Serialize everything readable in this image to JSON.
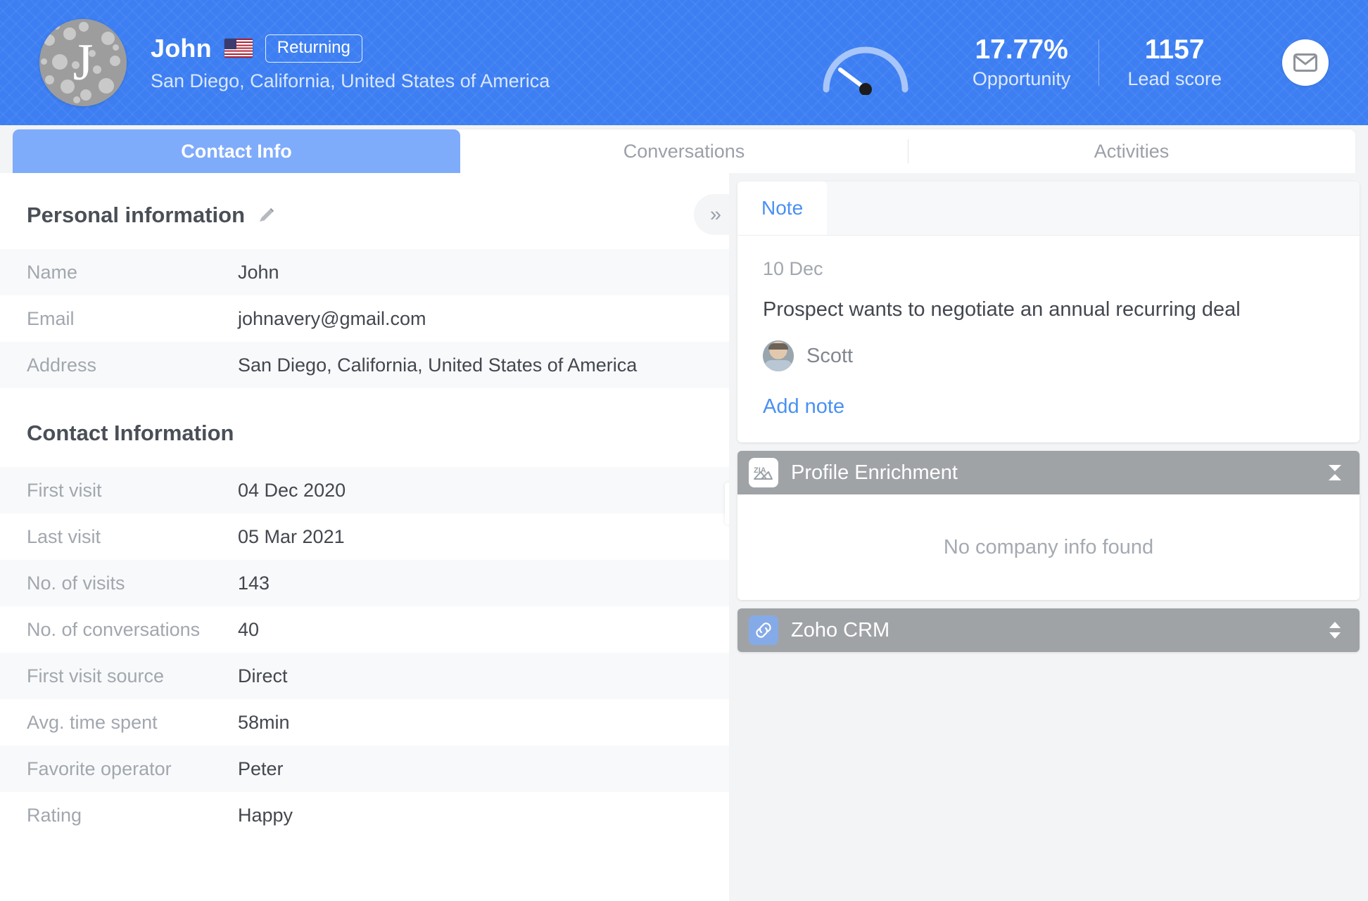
{
  "header": {
    "avatar_letter": "J",
    "name": "John",
    "country_flag": "us-flag-icon",
    "badge": "Returning",
    "location": "San Diego, California, United States of America",
    "gauge_icon": "gauge-icon",
    "opportunity_value": "17.77%",
    "opportunity_label": "Opportunity",
    "lead_score_value": "1157",
    "lead_score_label": "Lead score",
    "mail_icon": "mail-icon",
    "accent_color": "#3d7ff2"
  },
  "tabs": [
    {
      "label": "Contact Info",
      "active": true
    },
    {
      "label": "Conversations",
      "active": false
    },
    {
      "label": "Activities",
      "active": false
    }
  ],
  "personal": {
    "title": "Personal information",
    "edit_icon": "pencil-icon",
    "rows": [
      {
        "label": "Name",
        "value": "John"
      },
      {
        "label": "Email",
        "value": "johnavery@gmail.com"
      },
      {
        "label": "Address",
        "value": "San Diego, California, United States of America"
      }
    ]
  },
  "contact": {
    "title": "Contact Information",
    "rows": [
      {
        "label": "First visit",
        "value": "04 Dec 2020"
      },
      {
        "label": "Last visit",
        "value": "05 Mar 2021"
      },
      {
        "label": "No. of visits",
        "value": "143"
      },
      {
        "label": "No. of conversations",
        "value": "40"
      },
      {
        "label": "First visit source",
        "value": "Direct"
      },
      {
        "label": "Avg. time spent",
        "value": "58min"
      },
      {
        "label": "Favorite operator",
        "value": "Peter"
      },
      {
        "label": "Rating",
        "value": "Happy"
      }
    ]
  },
  "collapse_handle": {
    "icon": "chevron-double-right-icon",
    "glyph": "»"
  },
  "resize_handle": {
    "icon": "drag-handle-icon"
  },
  "note_card": {
    "tab_label": "Note",
    "date": "10 Dec",
    "text": "Prospect wants to negotiate an annual recurring deal",
    "author": "Scott",
    "author_avatar": "user-avatar",
    "add_note_label": "Add note",
    "link_color": "#4a90f5"
  },
  "profile_enrichment": {
    "icon": "zia-icon",
    "title": "Profile Enrichment",
    "collapse_icon": "collapse-vertical-icon",
    "empty_text": "No company info found",
    "header_color": "#a0a3a6"
  },
  "zoho_crm": {
    "icon": "link-icon",
    "title": "Zoho CRM",
    "expand_icon": "expand-vertical-icon",
    "header_color": "#a0a3a6"
  }
}
